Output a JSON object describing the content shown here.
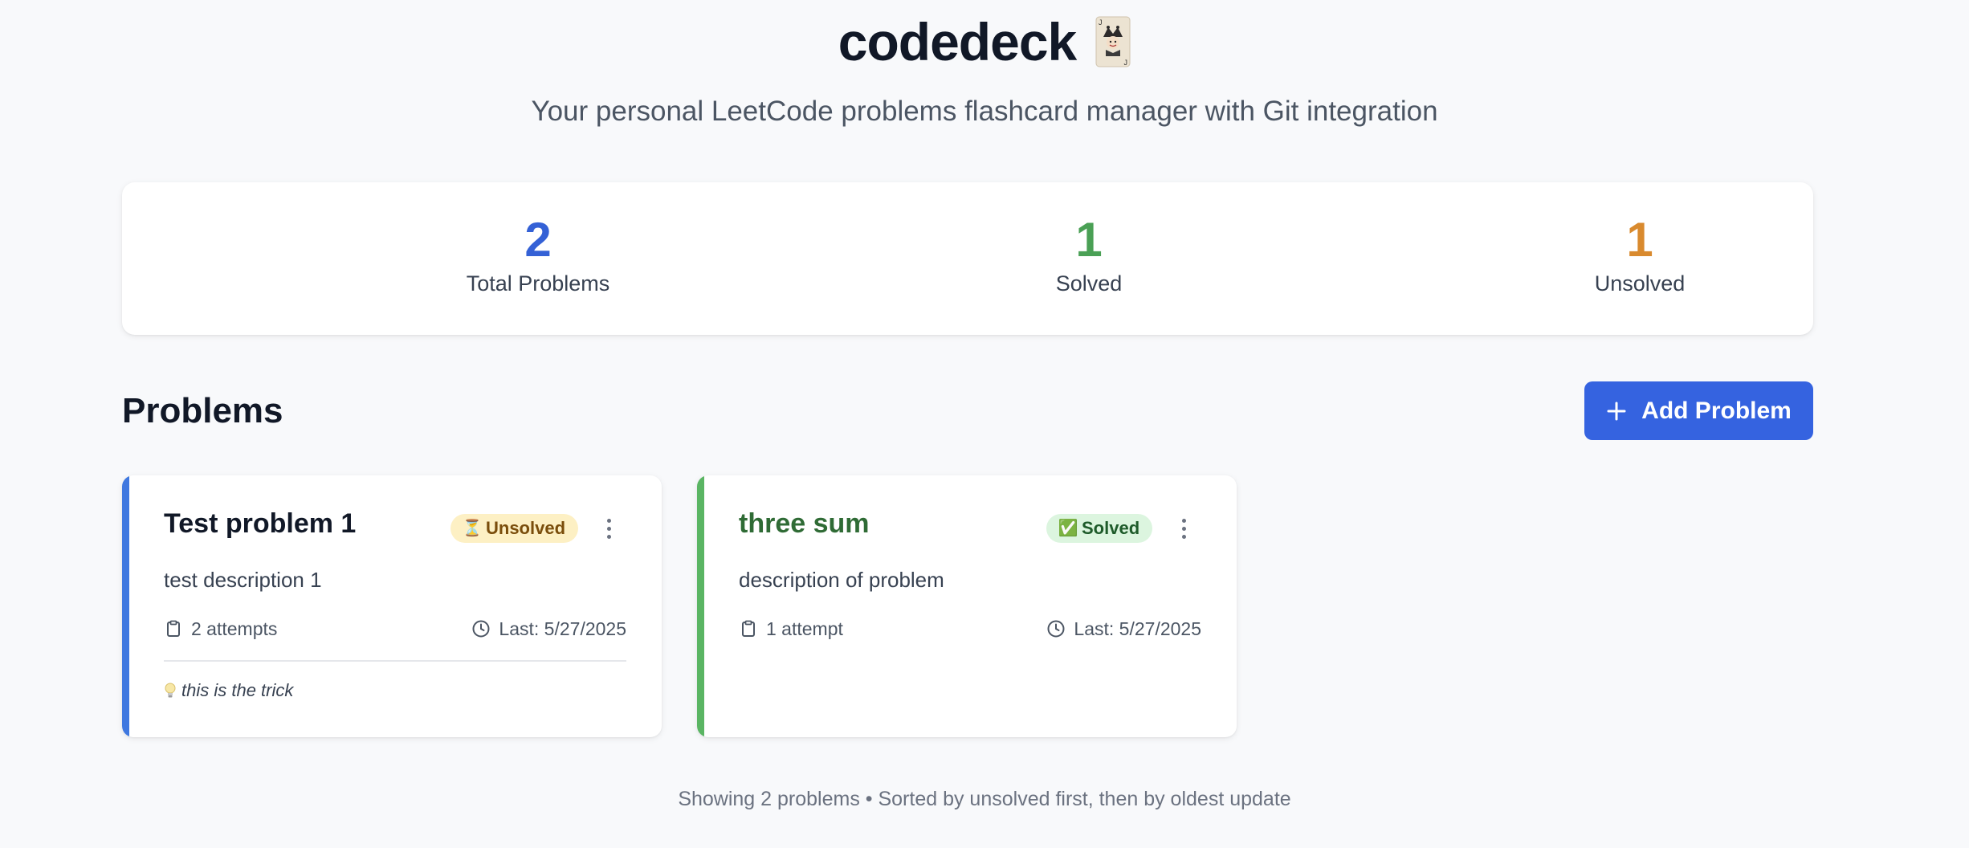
{
  "app": {
    "title": "codedeck",
    "logo_icon": "joker-card-icon",
    "subtitle": "Your personal LeetCode problems flashcard manager with Git integration"
  },
  "stats": {
    "total": {
      "value": "2",
      "label": "Total Problems",
      "color": "#3461d6"
    },
    "solved": {
      "value": "1",
      "label": "Solved",
      "color": "#4aa055"
    },
    "unsolved": {
      "value": "1",
      "label": "Unsolved",
      "color": "#d98a2e"
    }
  },
  "problems_section": {
    "title": "Problems",
    "add_button_label": "Add Problem",
    "add_button_icon": "plus-icon"
  },
  "problems": [
    {
      "title": "Test problem 1",
      "title_color": "#111827",
      "accent_color": "#3f78e0",
      "status": "Unsolved",
      "status_icon": "⏳",
      "description": "test description 1",
      "attempts": "2 attempts",
      "last": "Last: 5/27/2025",
      "hint": "this is the trick"
    },
    {
      "title": "three sum",
      "title_color": "#2f6b35",
      "accent_color": "#5ab563",
      "status": "Solved",
      "status_icon": "✅",
      "description": "description of problem",
      "attempts": "1 attempt",
      "last": "Last: 5/27/2025"
    }
  ],
  "footer": {
    "text": "Showing 2 problems • Sorted by unsolved first, then by oldest update"
  }
}
